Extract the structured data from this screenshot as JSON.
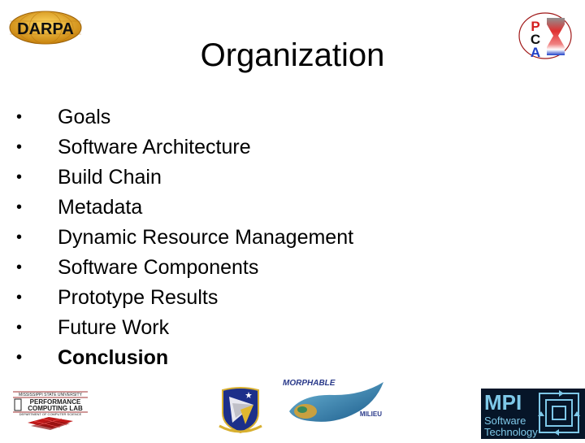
{
  "slide": {
    "title": "Organization",
    "bullet_char": "•",
    "items": [
      {
        "label": "Goals",
        "bold": false
      },
      {
        "label": "Software Architecture",
        "bold": false
      },
      {
        "label": "Build Chain",
        "bold": false
      },
      {
        "label": "Metadata",
        "bold": false
      },
      {
        "label": "Dynamic Resource Management",
        "bold": false
      },
      {
        "label": "Software Components",
        "bold": false
      },
      {
        "label": "Prototype Results",
        "bold": false
      },
      {
        "label": "Future Work",
        "bold": false
      },
      {
        "label": "Conclusion",
        "bold": true
      }
    ]
  },
  "logos": {
    "darpa": {
      "text": "DARPA"
    },
    "pca": {
      "letters": [
        "P",
        "C",
        "A"
      ]
    },
    "msu": {
      "line1": "MISSISSIPPI STATE UNIVERSITY",
      "line2": "PERFORMANCE",
      "line3": "COMPUTING LAB",
      "line4": "DEPARTMENT OF COMPUTER SCIENCE"
    },
    "morphable": {
      "line1": "MORPHABLE",
      "line2": "MILIEU"
    },
    "mpi": {
      "line1": "MPI",
      "line2": "Software",
      "line3": "Technology"
    }
  },
  "colors": {
    "darpa_gold": "#e0a020",
    "pca_red": "#d42020",
    "pca_blue": "#2040c8",
    "msu_red": "#c01818",
    "mpi_bg": "#061528",
    "mpi_cyan": "#7ec8e8"
  }
}
